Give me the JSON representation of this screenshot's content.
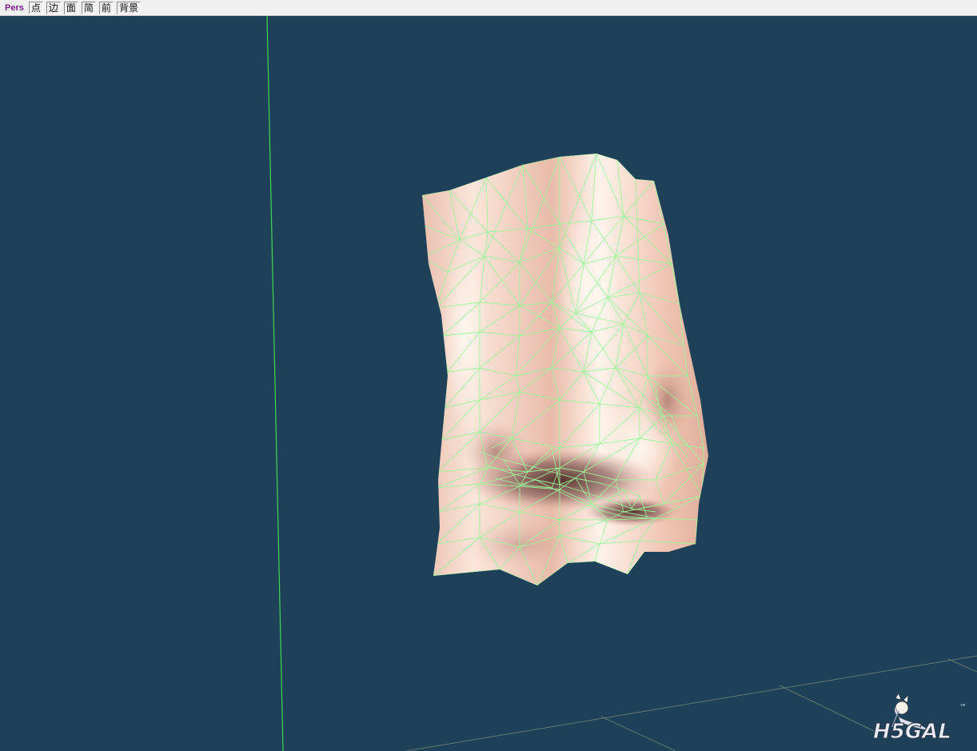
{
  "toolbar": {
    "view_mode": "Pers",
    "buttons": [
      {
        "label": "点"
      },
      {
        "label": "边"
      },
      {
        "label": "面"
      },
      {
        "label": "简"
      },
      {
        "label": "前"
      },
      {
        "label": "背景"
      }
    ]
  },
  "viewport": {
    "background_color": "#1e4159",
    "axis_color": "#3fd84a",
    "wireframe_color": "#9ef59a",
    "mesh_base_color": "#f3c9b4"
  },
  "watermark": {
    "text": "H5GAL",
    "tm": "™"
  }
}
